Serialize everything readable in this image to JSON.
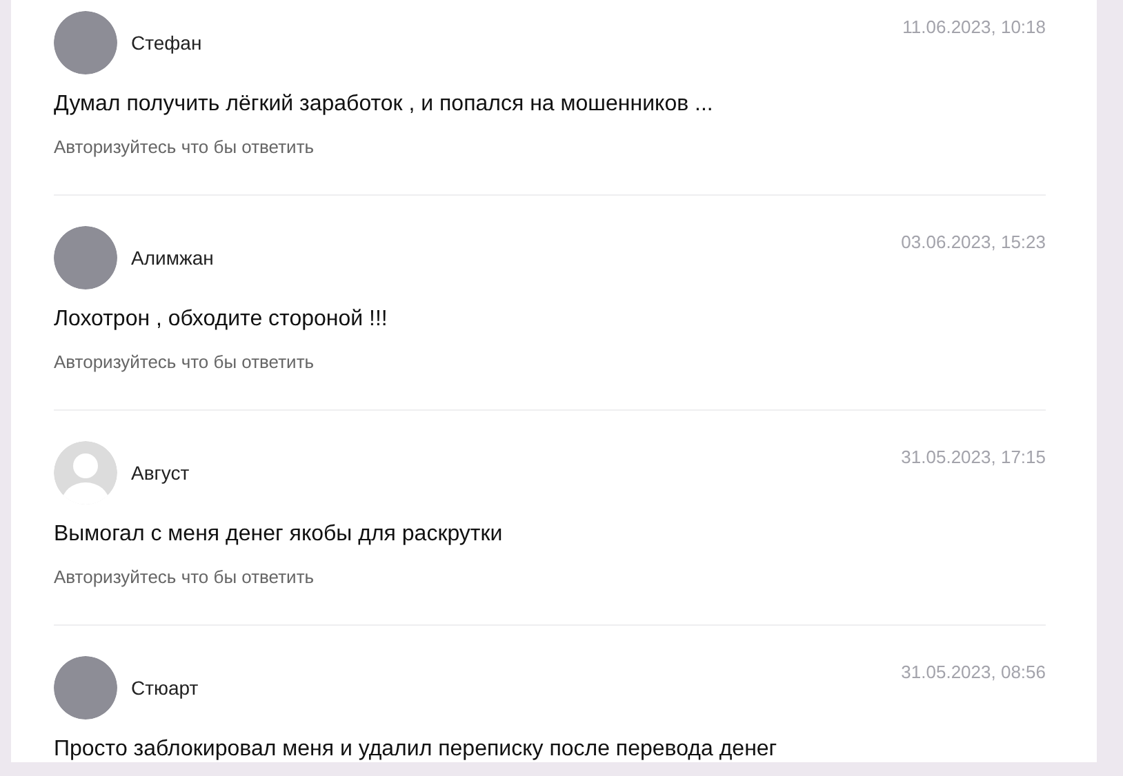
{
  "comments": [
    {
      "author": "Стефан",
      "avatar": {
        "kind": "photo"
      },
      "date": "11.06.2023, 10:18",
      "text": "Думал получить лёгкий заработок , и попался на мошенников ...",
      "reply_link": "Авторизуйтесь что бы ответить"
    },
    {
      "author": "Алимжан",
      "avatar": {
        "kind": "photo"
      },
      "date": "03.06.2023, 15:23",
      "text": "Лохотрон , обходите стороной !!!",
      "reply_link": "Авторизуйтесь что бы ответить"
    },
    {
      "author": "Август",
      "avatar": {
        "kind": "default"
      },
      "date": "31.05.2023, 17:15",
      "text": "Вымогал с меня денег якобы для раскрутки",
      "reply_link": "Авторизуйтесь что бы ответить"
    },
    {
      "author": "Стюарт",
      "avatar": {
        "kind": "photo"
      },
      "date": "31.05.2023, 08:56",
      "text": "Просто заблокировал меня и удалил переписку после перевода денег"
    }
  ]
}
